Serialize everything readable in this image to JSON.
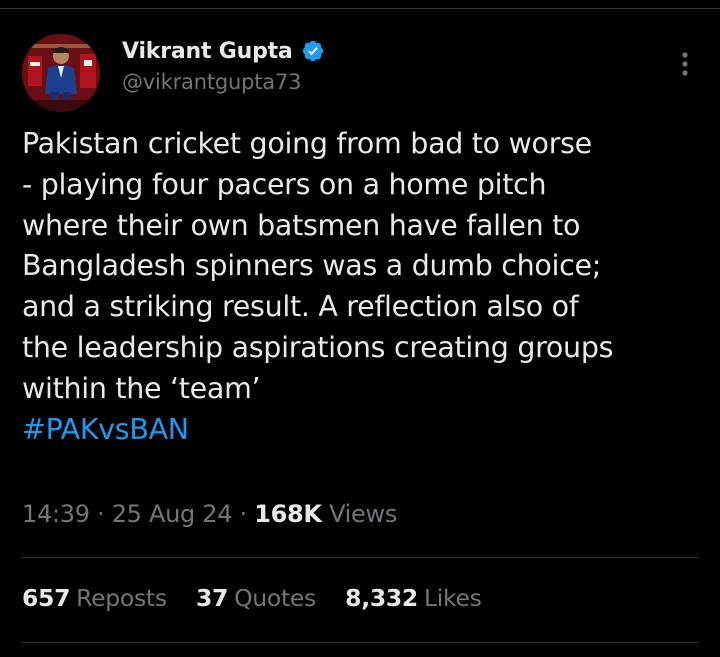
{
  "colors": {
    "background": "#000000",
    "text_primary": "#e7e9ea",
    "text_secondary": "#71767b",
    "accent": "#1d9bf0",
    "divider": "#2f3336"
  },
  "author": {
    "display_name": "Vikrant Gupta",
    "handle": "@vikrantgupta73",
    "verified_icon": "verified-badge-icon",
    "avatar_icon": "avatar"
  },
  "more_icon": "more-options-icon",
  "tweet": {
    "lines": [
      "Pakistan cricket going from bad to worse",
      "- playing four pacers on a home pitch",
      "where their own batsmen have fallen to",
      "Bangladesh spinners was a dumb choice;",
      "and a striking result. A reflection also of",
      "the leadership aspirations creating groups",
      "within the ‘team’"
    ],
    "hashtag": "#PAKvsBAN"
  },
  "meta": {
    "time": "14:39",
    "date": "25 Aug 24",
    "separator": "·",
    "views_count": "168K",
    "views_label": "Views"
  },
  "stats": {
    "reposts_count": "657",
    "reposts_label": "Reposts",
    "quotes_count": "37",
    "quotes_label": "Quotes",
    "likes_count": "8,332",
    "likes_label": "Likes"
  }
}
